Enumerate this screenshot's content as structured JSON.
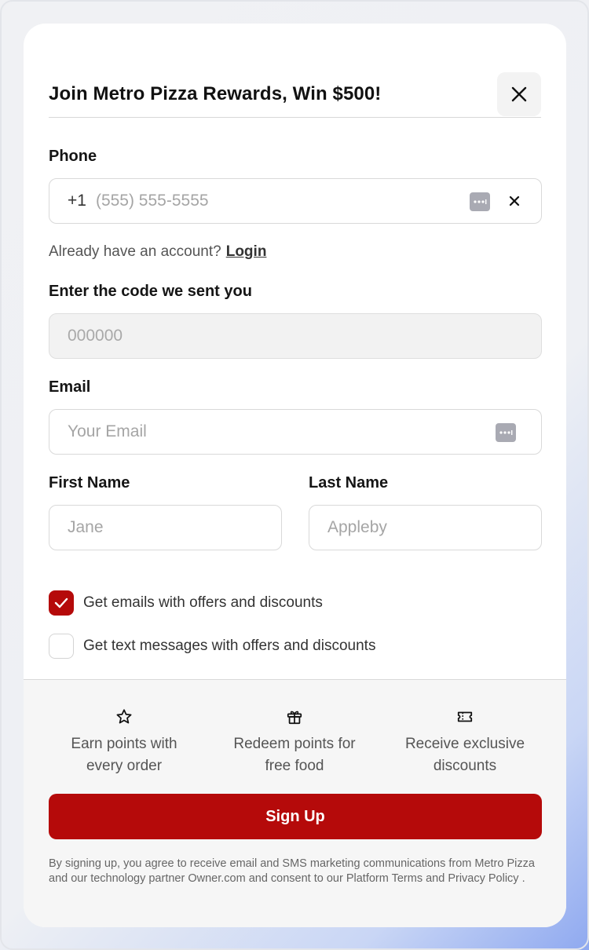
{
  "modal": {
    "title": "Join Metro Pizza Rewards, Win $500!"
  },
  "phone": {
    "label": "Phone",
    "prefix": "+1",
    "placeholder": "(555) 555-5555"
  },
  "login_prompt": {
    "text": "Already have an account?",
    "link": "Login"
  },
  "code": {
    "label": "Enter the code we sent you",
    "placeholder": "000000"
  },
  "email": {
    "label": "Email",
    "placeholder": "Your Email"
  },
  "first_name": {
    "label": "First Name",
    "placeholder": "Jane"
  },
  "last_name": {
    "label": "Last Name",
    "placeholder": "Appleby"
  },
  "opt_ins": [
    {
      "label": "Get emails with offers and discounts",
      "checked": true
    },
    {
      "label": "Get text messages with offers and discounts",
      "checked": false
    }
  ],
  "benefits": [
    {
      "icon": "star-icon",
      "line1": "Earn points with",
      "line2": "every order"
    },
    {
      "icon": "gift-icon",
      "line1": "Redeem points for",
      "line2": "free food"
    },
    {
      "icon": "ticket-icon",
      "line1": "Receive exclusive",
      "line2": "discounts"
    }
  ],
  "signup_label": "Sign Up",
  "legal": "By signing up, you agree to receive email and SMS marketing communications from Metro Pizza and our technology partner Owner.com and consent to our Platform Terms and Privacy Policy .",
  "colors": {
    "brand": "#b50a0a",
    "key_icon": "#a9aab3"
  }
}
